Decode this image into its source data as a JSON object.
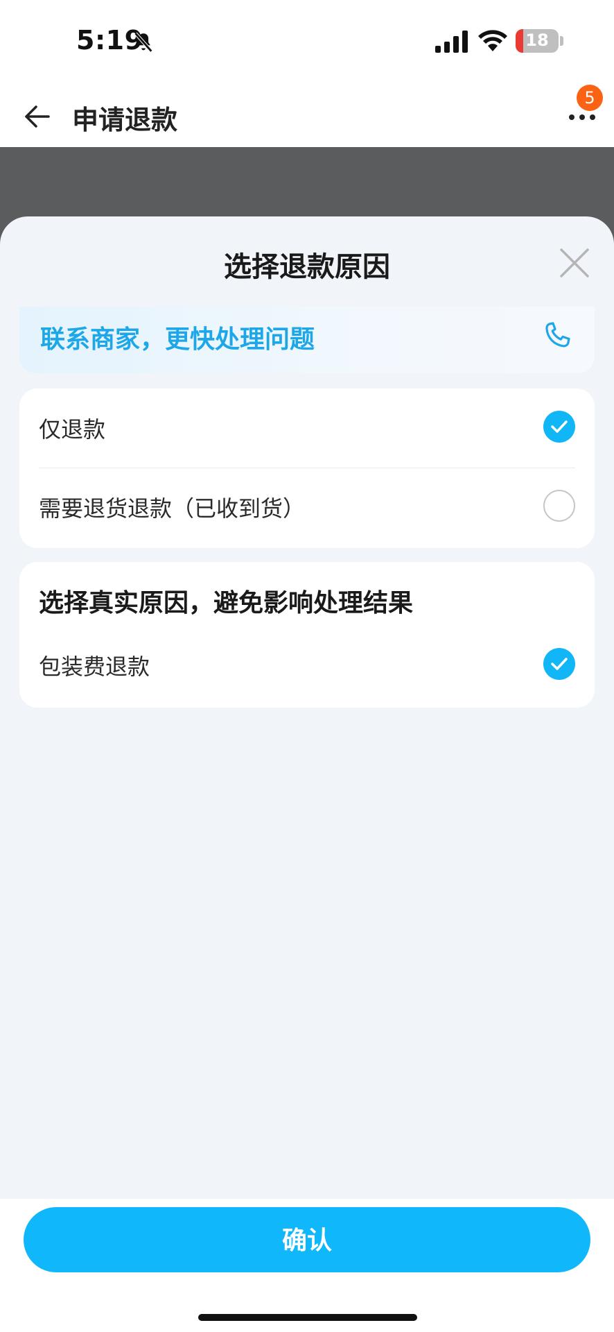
{
  "status_bar": {
    "time": "5:19",
    "battery_level": "18",
    "icons": [
      "bell-off-icon",
      "signal-icon",
      "wifi-icon",
      "battery-icon"
    ]
  },
  "header": {
    "title": "申请退款",
    "notification_count": "5",
    "icons": [
      "back-arrow-icon",
      "more-icon"
    ]
  },
  "sheet": {
    "title": "选择退款原因",
    "contact_merchant": "联系商家，更快处理问题",
    "refund_types": [
      {
        "label": "仅退款",
        "checked": true
      },
      {
        "label": "需要退货退款（已收到货）",
        "checked": false
      }
    ],
    "reasons_heading": "选择真实原因，避免影响处理结果",
    "reasons": [
      {
        "label": "包装费退款",
        "checked": true
      }
    ],
    "confirm_label": "确认"
  },
  "colors": {
    "accent": "#10B8FB",
    "contact_text": "#1EA7E8",
    "badge": "#FB6214",
    "battery_low": "#EA3A34",
    "overlay": "#5B5C5E"
  }
}
